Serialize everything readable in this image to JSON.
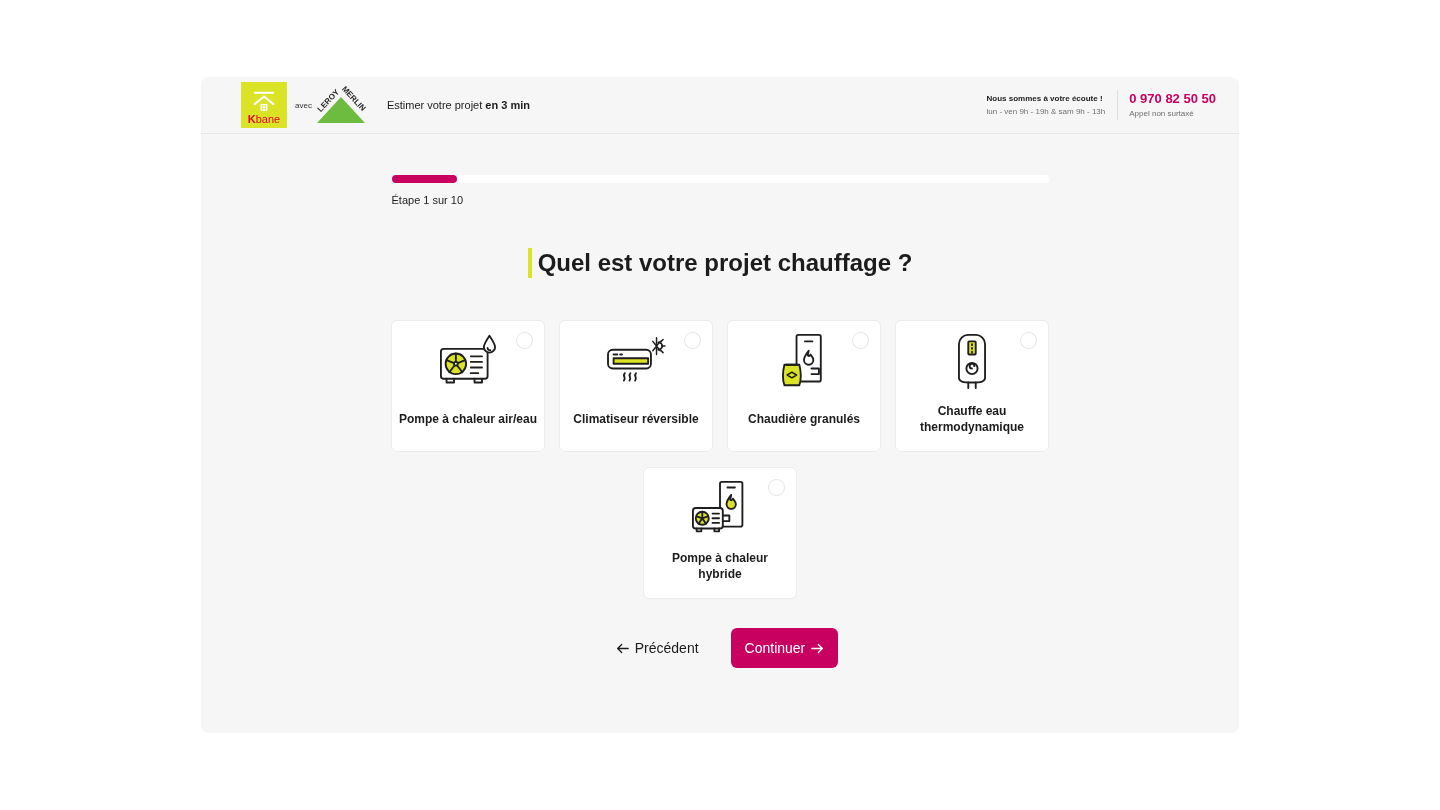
{
  "header": {
    "logo": {
      "text": "**K**bane"
    },
    "partner_prefix": "avec",
    "partner_logo": {
      "words": [
        "LEROY",
        "MERLIN"
      ]
    },
    "tagline": "Estimer votre projet **en 3 min**",
    "contact": {
      "title": "Nous sommes à votre écoute !",
      "hours": "lun - ven 9h - 19h & sam 9h - 13h",
      "phone": "0 970 82 50 50",
      "phone_note": "Appel non surtaxé"
    }
  },
  "progress": {
    "level": 0.1,
    "label": "Étape 1 sur 10"
  },
  "question": "Quel est votre projet chauffage ?",
  "options": [
    {
      "label": "Pompe à chaleur air/eau",
      "selected": false
    },
    {
      "label": "Climatiseur réversible",
      "selected": false
    },
    {
      "label": "Chaudière granulés",
      "selected": false
    },
    {
      "label": "Chauffe eau thermodynamique",
      "selected": false
    },
    {
      "label": "Pompe à chaleur hybride",
      "selected": false
    }
  ],
  "buttons": [
    {
      "kind": "back",
      "label": "Précédent"
    },
    {
      "kind": "next",
      "label": "Continuer"
    }
  ]
}
